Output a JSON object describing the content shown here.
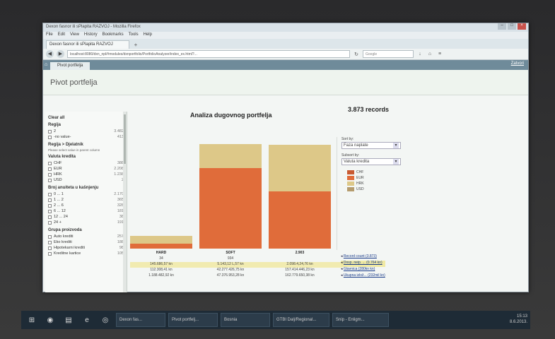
{
  "browser": {
    "title": "Dexon fasnor ili sPlapita RAZVOJ - Mozilla Firefox",
    "menu": [
      "File",
      "Edit",
      "View",
      "History",
      "Bookmarks",
      "Tools",
      "Help"
    ],
    "tab_label": "Dexon fasnor ili sPlapita RAZVOJ",
    "url": "localhost:8080/dxn_npl/#modules/dxnportfolio/PortfolioAnalyzer/index_ex.html?...",
    "search_placeholder": "Google"
  },
  "app": {
    "tab_label": "Pivot portfelja",
    "page_title": "Pivot portfelja",
    "top_right_link": "Zatvori"
  },
  "sidebar": {
    "clear_all": "Clear all",
    "sections": [
      {
        "title": "Regija",
        "rows": [
          {
            "label": "2",
            "count": "3.482"
          },
          {
            "label": "-no value-",
            "count": "413"
          }
        ]
      },
      {
        "title": "Regija > Djelatnik",
        "note": "Please select value in parent column",
        "rows": []
      },
      {
        "title": "Valuta kredita",
        "rows": [
          {
            "label": "CHF",
            "count": "388"
          },
          {
            "label": "EUR",
            "count": "2.208"
          },
          {
            "label": "HRK",
            "count": "1.238"
          },
          {
            "label": "USD",
            "count": "2"
          }
        ]
      },
      {
        "title": "Broj anuiteta u kašnjenju",
        "rows": [
          {
            "label": "0 ... 1",
            "count": "2.170"
          },
          {
            "label": "1 ... 2",
            "count": "365"
          },
          {
            "label": "2 ... 6",
            "count": "328"
          },
          {
            "label": "6 ... 12",
            "count": "181"
          },
          {
            "label": "12 ... 24",
            "count": "38"
          },
          {
            "label": "24 +",
            "count": "191"
          }
        ]
      },
      {
        "title": "Grupa proizvoda",
        "rows": [
          {
            "label": "Auto krediti",
            "count": "257"
          },
          {
            "label": "Eko krediti",
            "count": "188"
          },
          {
            "label": "Hipotekarni krediti",
            "count": "98"
          },
          {
            "label": "Kreditne kartice",
            "count": "105"
          }
        ]
      }
    ]
  },
  "chart": {
    "title": "Analiza dugovnog portfelja",
    "records": "3.873 records",
    "sort_label": "Sort by:",
    "sort_value": "Faza naplate",
    "subsort_label": "Subsort by:",
    "subsort_value": "Valuta kredita",
    "legend": [
      {
        "name": "CHF",
        "color": "#c85a32"
      },
      {
        "name": "EUR",
        "color": "#e06c3a"
      },
      {
        "name": "HRK",
        "color": "#ddc888"
      },
      {
        "name": "USD",
        "color": "#b59c6e"
      }
    ],
    "links": [
      {
        "text": "Record count (3.873)"
      },
      {
        "text": "Dosp. neip. ... (0.764 kn)"
      },
      {
        "text": "Glavnica (280kn kn)"
      },
      {
        "text": "Ukupna izlož... (232mil kn)"
      }
    ]
  },
  "chart_data": {
    "type": "bar",
    "categories": [
      "HARD",
      "SOFT",
      "2.903"
    ],
    "series": [
      {
        "name": "EUR",
        "values": [
          120,
          2010,
          1430
        ]
      },
      {
        "name": "HRK",
        "values": [
          200,
          600,
          1170
        ]
      }
    ],
    "data_labels": [
      [
        "34",
        "145.686,57 kn",
        "112.308,41 kn",
        "1.188.482,92 kn"
      ],
      [
        "934",
        "5.143,12 L,57 kn",
        "42.277.426,75 kn",
        "47.376.953,28 kn"
      ],
      [
        "",
        "2.098.4,24,76 kn",
        "157.414.446,23 kn",
        "162.779.650,38 kn"
      ]
    ],
    "ylim": [
      0,
      3000
    ]
  },
  "taskbar": {
    "items": [
      "Dexon fas...",
      "Pivot portfelj...",
      "Bosnia",
      "GTBI Dalj/Regional...",
      "Snip - Enligm..."
    ],
    "clock": "15:13",
    "date": "8.6.2013."
  }
}
